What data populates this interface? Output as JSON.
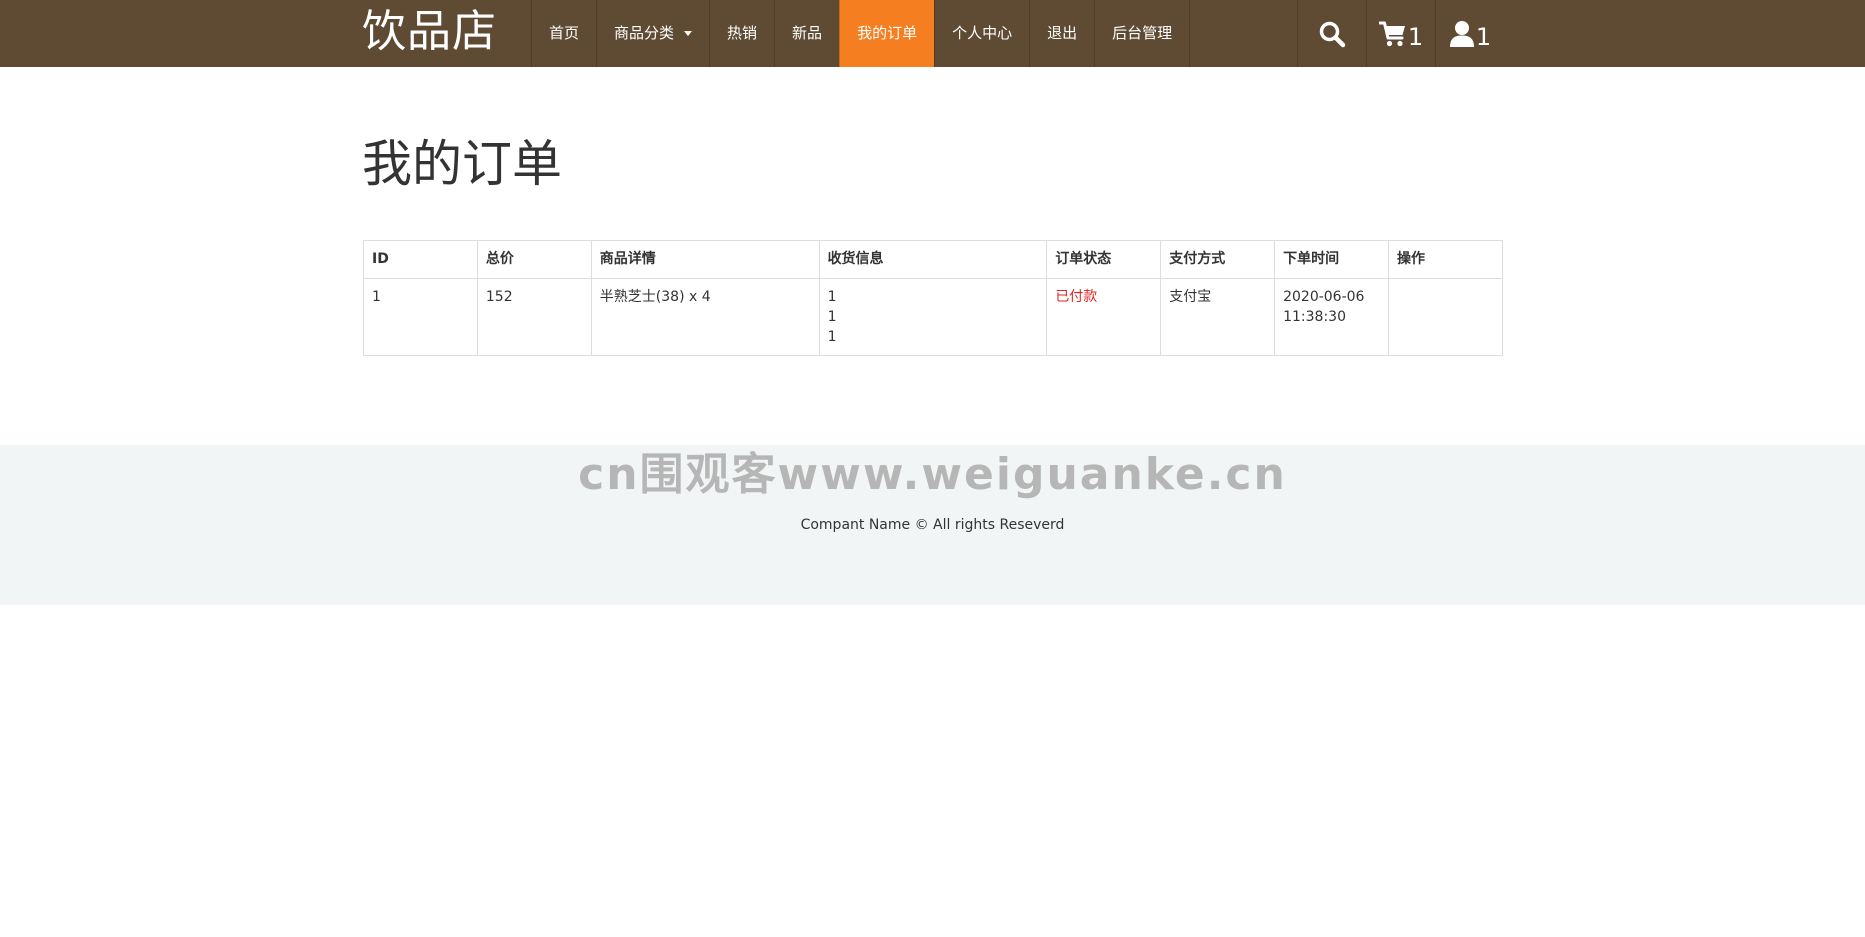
{
  "navbar": {
    "brand": "饮品店",
    "items": [
      {
        "label": "首页"
      },
      {
        "label": "商品分类",
        "has_caret": true
      },
      {
        "label": "热销"
      },
      {
        "label": "新品"
      },
      {
        "label": "我的订单",
        "active": true
      },
      {
        "label": "个人中心"
      },
      {
        "label": "退出"
      },
      {
        "label": "后台管理"
      }
    ],
    "search_icon": "search-icon",
    "cart_icon": "cart-icon",
    "cart_count": "1",
    "user_icon": "user-icon",
    "user_count": "1",
    "accent_color": "#f47e20",
    "bar_color": "#5f4b33"
  },
  "main": {
    "title": "我的订单",
    "table": {
      "headers": [
        "ID",
        "总价",
        "商品详情",
        "收货信息",
        "订单状态",
        "支付方式",
        "下单时间",
        "操作"
      ],
      "rows": [
        {
          "id": "1",
          "total": "152",
          "items": "半熟芝士(38) x 4",
          "shipping": [
            "1",
            "1",
            "1"
          ],
          "status": "已付款",
          "payment": "支付宝",
          "date": "2020-06-06",
          "time": "11:38:30",
          "actions": ""
        }
      ],
      "status_color": "#e02424"
    }
  },
  "footer": {
    "watermark": "cn围观客www.weiguanke.cn",
    "copyright": "Compant Name © All rights Reseverd"
  }
}
